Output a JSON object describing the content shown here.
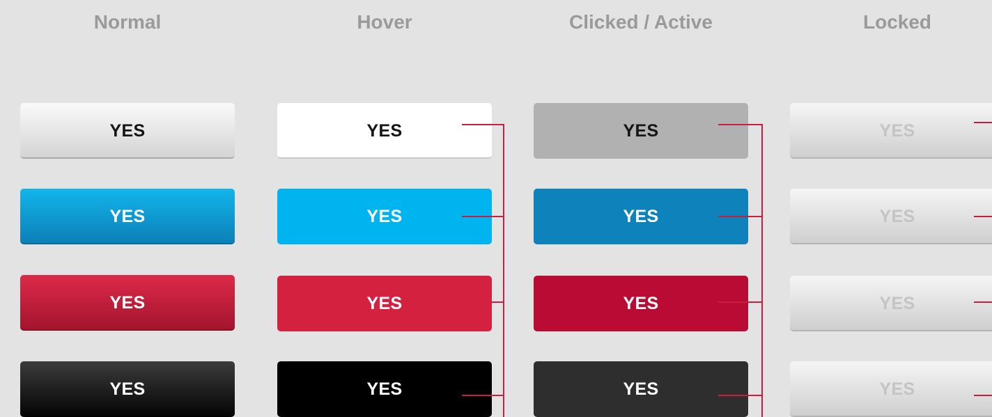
{
  "headers": {
    "normal": "Normal",
    "hover": "Hover",
    "active": "Clicked / Active",
    "locked": "Locked"
  },
  "button_label": "YES",
  "variants": [
    "white",
    "blue",
    "red",
    "black"
  ],
  "colors": {
    "background": "#e3e3e3",
    "header_text": "#9a9a9a",
    "connector": "#cc1d3e",
    "normal": {
      "white": "#e8e8e8",
      "blue": "#0ea0d8",
      "red": "#c21c3a",
      "black": "#1e1e1e"
    },
    "hover": {
      "white": "#ffffff",
      "blue": "#00b4ef",
      "red": "#d52140",
      "black": "#000000"
    },
    "active": {
      "white": "#b1b1b1",
      "blue": "#0e82bb",
      "red": "#b90b33",
      "black": "#2e2e2e"
    },
    "locked": {
      "background": "#e6e6e6",
      "text": "#c4c4c4"
    }
  }
}
